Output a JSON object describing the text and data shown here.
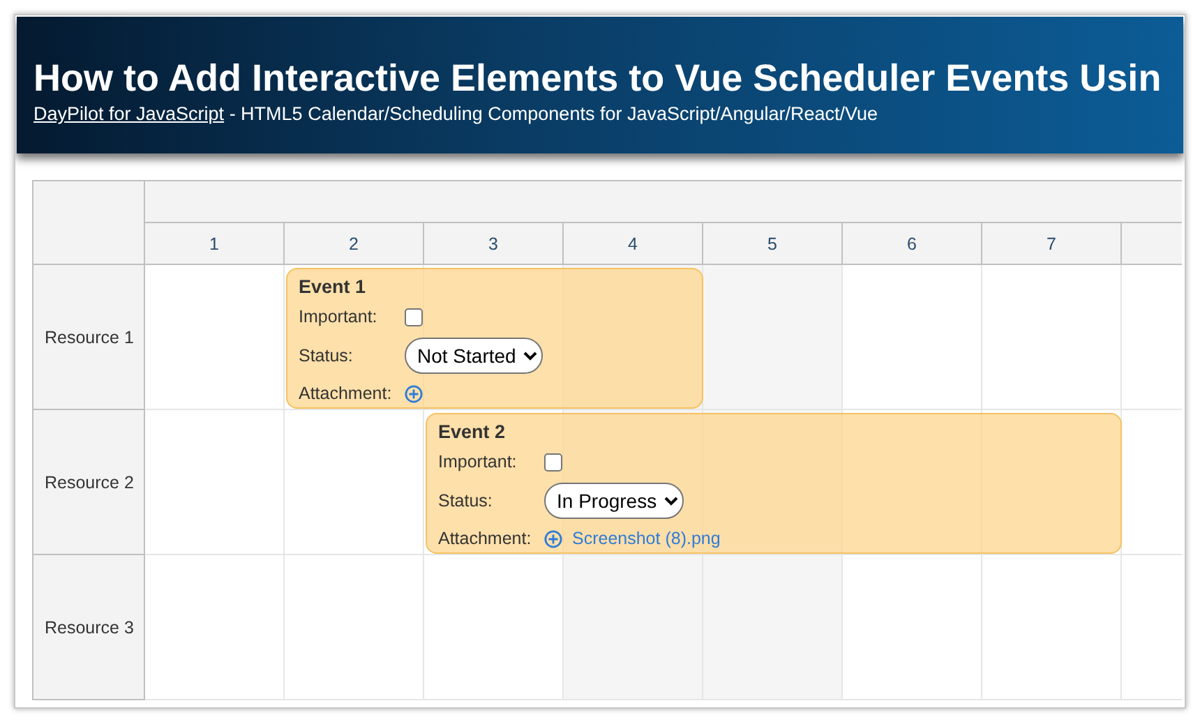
{
  "header": {
    "title": "How to Add Interactive Elements to Vue Scheduler Events Usin",
    "link": "DayPilot for JavaScript",
    "subtitle": " - HTML5 Calendar/Scheduling Components for JavaScript/Angular/React/Vue"
  },
  "scheduler": {
    "columns": [
      {
        "label": "1",
        "color": "#ffffff"
      },
      {
        "label": "2",
        "color": "#ffffff"
      },
      {
        "label": "3",
        "color": "#ffffff"
      },
      {
        "label": "4",
        "color": "#f5f5f5"
      },
      {
        "label": "5",
        "color": "#f5f5f5"
      },
      {
        "label": "6",
        "color": "#ffffff"
      },
      {
        "label": "7",
        "color": "#ffffff"
      }
    ],
    "resources": [
      {
        "name": "Resource 1",
        "events": [
          {
            "title": "Event 1",
            "important_label": "Important:",
            "important": false,
            "status_label": "Status:",
            "status": "Not Started",
            "attachment_label": "Attachment:"
          }
        ]
      },
      {
        "name": "Resource 2",
        "events": [
          {
            "title": "Event 2",
            "important_label": "Important:",
            "important": false,
            "status_label": "Status:",
            "status": "In Progress",
            "attachment_label": "Attachment:",
            "attachment": "Screenshot (8).png"
          }
        ]
      },
      {
        "name": "Resource 3"
      }
    ]
  }
}
